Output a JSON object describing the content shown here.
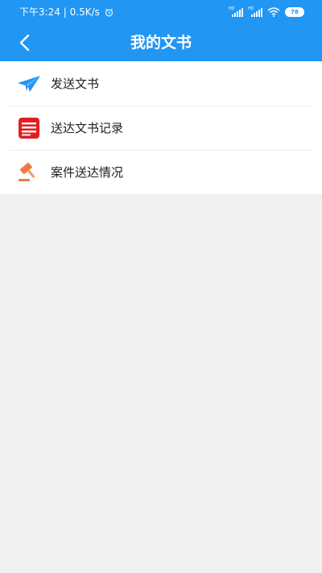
{
  "status_bar": {
    "time_speed": "下午3:24 | 0.5K/s",
    "network_1": "HD",
    "network_2": "HD",
    "battery": "78"
  },
  "header": {
    "title": "我的文书"
  },
  "menu": {
    "items": [
      {
        "label": "发送文书",
        "icon": "paper-plane-icon"
      },
      {
        "label": "送达文书记录",
        "icon": "document-record-icon"
      },
      {
        "label": "案件送达情况",
        "icon": "gavel-icon"
      }
    ]
  },
  "colors": {
    "header_bg": "#2196f3",
    "page_bg": "#f0f0f0",
    "plane": "#2196f3",
    "record": "#e02020",
    "gavel": "#f07b3f"
  }
}
